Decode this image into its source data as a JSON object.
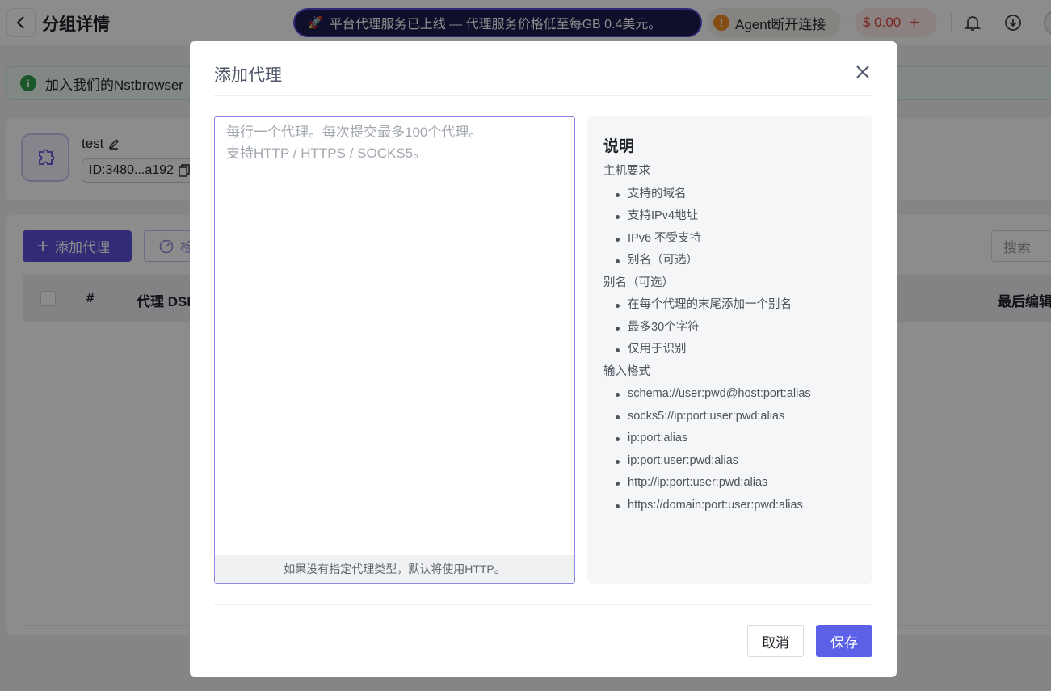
{
  "header": {
    "title": "分组详情",
    "announcement": "平台代理服务已上线 — 代理服务价格低至每GB 0.4美元。",
    "agent_status": "Agent断开连接",
    "balance": "$ 0.00"
  },
  "notice": {
    "text": "加入我们的Nstbrowser"
  },
  "group": {
    "name": "test",
    "id": "ID:3480...a192"
  },
  "toolbar": {
    "add_proxy_label": "添加代理",
    "check_label": "检",
    "search_placeholder": "搜索"
  },
  "table": {
    "columns": [
      "#",
      "代理 DSL",
      "最后编辑"
    ]
  },
  "modal": {
    "title": "添加代理",
    "textarea_placeholder": "每行一个代理。每次提交最多100个代理。\n支持HTTP / HTTPS / SOCKS5。",
    "textarea_footer": "如果没有指定代理类型，默认将使用HTTP。",
    "help": {
      "title": "说明",
      "sections": [
        {
          "heading": "主机要求",
          "items": [
            "支持的域名",
            "支持IPv4地址",
            "IPv6 不受支持",
            "别名（可选）"
          ]
        },
        {
          "heading": "别名（可选）",
          "items": [
            "在每个代理的末尾添加一个别名",
            "最多30个字符",
            "仅用于识别"
          ]
        },
        {
          "heading": "输入格式",
          "items": [
            "schema://user:pwd@host:port:alias",
            "socks5://ip:port:user:pwd:alias",
            "ip:port:alias",
            "ip:port:user:pwd:alias",
            "http://ip:port:user:pwd:alias",
            "https://domain:port:user:pwd:alias"
          ]
        }
      ]
    },
    "cancel_label": "取消",
    "save_label": "保存"
  },
  "colors": {
    "accent": "#5b51d8",
    "save": "#5b61e6",
    "danger": "#e0443d",
    "warning": "#f08c24",
    "success": "#2e9d4a"
  },
  "icons": {
    "back": "chevron-left-icon",
    "rocket": "rocket-icon",
    "warning": "warning-icon",
    "bell": "bell-icon",
    "download": "download-icon",
    "info": "info-icon",
    "group": "puzzle-icon",
    "edit": "pencil-icon",
    "copy": "copy-icon",
    "close": "close-icon"
  }
}
